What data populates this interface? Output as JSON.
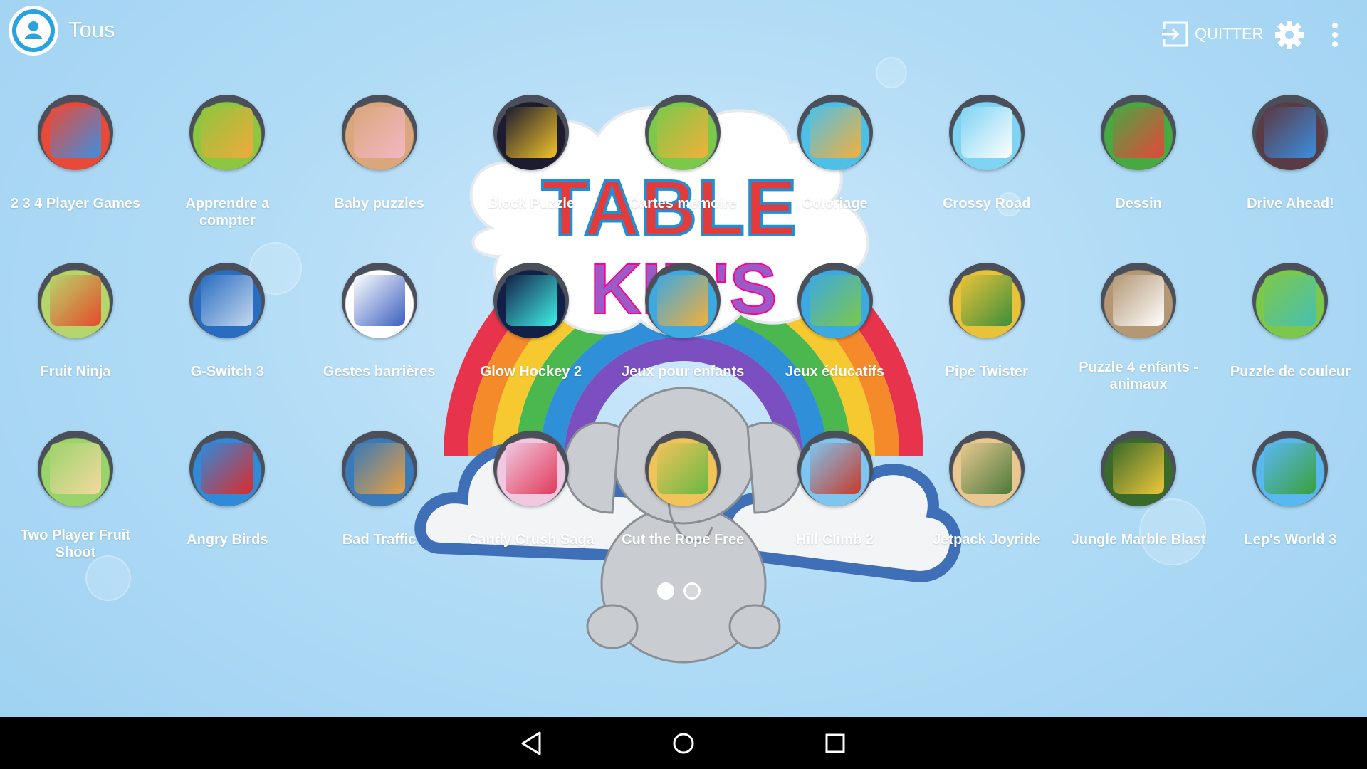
{
  "header": {
    "profile_name": "Tous",
    "quit_label": "QUITTER",
    "icons": [
      "user-icon",
      "exit-icon",
      "gear-icon",
      "more-vert-icon"
    ]
  },
  "background": {
    "logo_line1": "TABLE",
    "logo_line2": "KID'S"
  },
  "apps": [
    {
      "label": "2 3 4 Player Games",
      "icon": "multi-game-icon"
    },
    {
      "label": "Apprendre a compter",
      "icon": "bear-numbers-icon"
    },
    {
      "label": "Baby puzzles",
      "icon": "pig-puzzle-icon"
    },
    {
      "label": "Block Puzzle",
      "icon": "blocks-icon"
    },
    {
      "label": "Cartes mémoire",
      "icon": "bear-shapes-icon"
    },
    {
      "label": "Coloriage",
      "icon": "bear-pencils-icon"
    },
    {
      "label": "Crossy Road",
      "icon": "chicken-icon"
    },
    {
      "label": "Dessin",
      "icon": "bear-painter-icon"
    },
    {
      "label": "Drive Ahead!",
      "icon": "monster-truck-icon"
    },
    {
      "label": "Fruit Ninja",
      "icon": "watermelon-slice-icon"
    },
    {
      "label": "G-Switch 3",
      "icon": "runner-icon"
    },
    {
      "label": "Gestes barrières",
      "icon": "virus-shield-icon"
    },
    {
      "label": "Glow Hockey 2",
      "icon": "air-hockey-icon"
    },
    {
      "label": "Jeux pour enfants",
      "icon": "bear-blocks-icon"
    },
    {
      "label": "Jeux éducatifs",
      "icon": "bear-globe-icon"
    },
    {
      "label": "Pipe Twister",
      "icon": "pipes-icon"
    },
    {
      "label": "Puzzle 4 enfants - animaux",
      "icon": "cow-puzzle-icon"
    },
    {
      "label": "Puzzle de couleur",
      "icon": "bear-green-icon"
    },
    {
      "label": "Two Player Fruit Shoot",
      "icon": "slingshot-icon"
    },
    {
      "label": "Angry Birds",
      "icon": "red-bird-icon"
    },
    {
      "label": "Bad Traffic",
      "icon": "traffic-icon"
    },
    {
      "label": "Candy Crush Saga",
      "icon": "candy-icon"
    },
    {
      "label": "Cut the Rope Free",
      "icon": "om-nom-icon"
    },
    {
      "label": "Hill Climb 2",
      "icon": "jeep-icon"
    },
    {
      "label": "Jetpack Joyride",
      "icon": "jetpack-man-icon"
    },
    {
      "label": "Jungle Marble Blast",
      "icon": "marble-ring-icon"
    },
    {
      "label": "Lep's World 3",
      "icon": "leprechaun-icon"
    }
  ],
  "pager": {
    "pages": 2,
    "current": 1
  },
  "navbar": {
    "icons": [
      "back-icon",
      "home-icon",
      "recents-icon"
    ]
  },
  "colors": {
    "accent": "#29a3e0",
    "background": "#b2dcf6"
  }
}
